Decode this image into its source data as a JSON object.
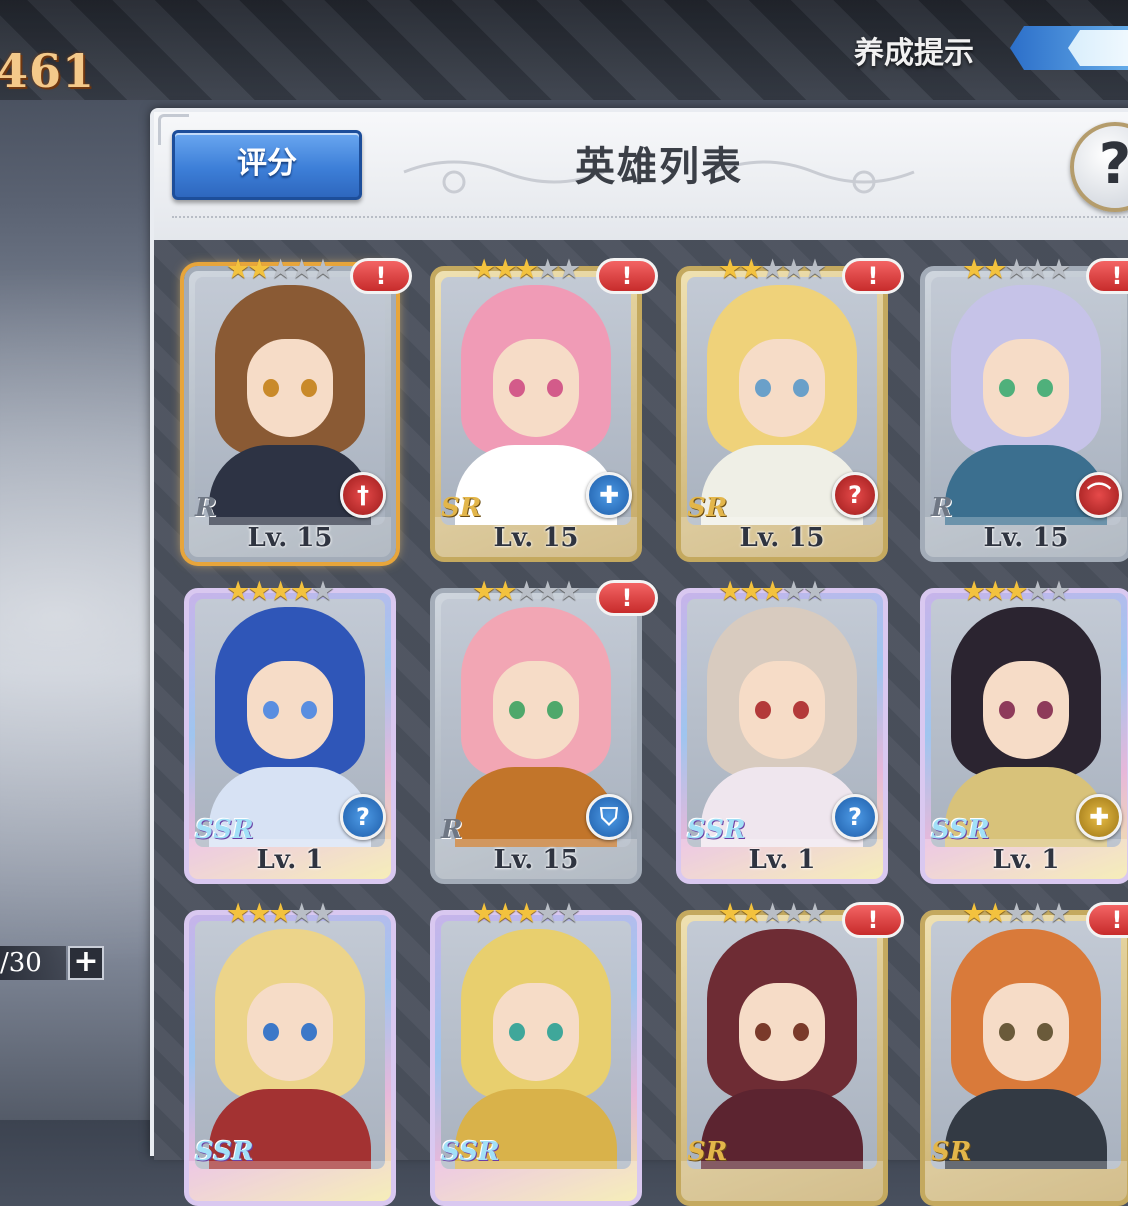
{
  "hud": {
    "currency": "461",
    "growth_hint": "养成提示",
    "stock": "/30",
    "plus": "+"
  },
  "panel": {
    "score_button": "评分",
    "title": "英雄列表",
    "help": "?"
  },
  "heroes": [
    {
      "rarity": "R",
      "level": "Lv. 15",
      "stars": 2,
      "alert": "!",
      "role": "sword-icon",
      "role_color": "red",
      "hair": "#8a5a34",
      "eyes": "#c98a2a",
      "body": "#2d3344",
      "selected": true
    },
    {
      "rarity": "SR",
      "level": "Lv. 15",
      "stars": 3,
      "alert": "!",
      "role": "healer-cross-icon",
      "role_color": "blue",
      "hair": "#f09bb6",
      "eyes": "#d35b8a",
      "body": "#ffffff",
      "selected": false
    },
    {
      "rarity": "SR",
      "level": "Lv. 15",
      "stars": 2,
      "alert": "!",
      "role": "mystery-question-icon",
      "role_color": "red",
      "hair": "#efd27a",
      "eyes": "#6aa0c9",
      "body": "#efefe6",
      "selected": false
    },
    {
      "rarity": "R",
      "level": "Lv. 15",
      "stars": 2,
      "alert": "!",
      "role": "bow-icon",
      "role_color": "red",
      "hair": "#c6c3e8",
      "eyes": "#4fb07b",
      "body": "#3b6f8f",
      "selected": false
    },
    {
      "rarity": "SSR",
      "level": "Lv. 1",
      "stars": 4,
      "alert": "",
      "role": "mystery-question-icon",
      "role_color": "blue",
      "hair": "#2f56b8",
      "eyes": "#5a8ee0",
      "body": "#d7e2f4",
      "selected": false
    },
    {
      "rarity": "R",
      "level": "Lv. 15",
      "stars": 2,
      "alert": "!",
      "role": "shield-icon",
      "role_color": "blue",
      "hair": "#f2a6b4",
      "eyes": "#4fa86b",
      "body": "#c2752a",
      "selected": false
    },
    {
      "rarity": "SSR",
      "level": "Lv. 1",
      "stars": 3,
      "alert": "",
      "role": "mystery-question-icon",
      "role_color": "blue",
      "hair": "#d8cbbf",
      "eyes": "#b33a3a",
      "body": "#efe6ee",
      "selected": false
    },
    {
      "rarity": "SSR",
      "level": "Lv. 1",
      "stars": 3,
      "alert": "",
      "role": "healer-cross-icon",
      "role_color": "gold",
      "hair": "#2b2430",
      "eyes": "#8e3b5a",
      "body": "#d8c27a",
      "selected": false
    },
    {
      "rarity": "SSR",
      "level": "",
      "stars": 3,
      "alert": "",
      "role": "",
      "role_color": "",
      "hair": "#ecd48a",
      "eyes": "#3c78c8",
      "body": "#a33232",
      "selected": false
    },
    {
      "rarity": "SSR",
      "level": "",
      "stars": 3,
      "alert": "",
      "role": "",
      "role_color": "",
      "hair": "#e8cf6e",
      "eyes": "#3fa79a",
      "body": "#d9b24a",
      "selected": false
    },
    {
      "rarity": "SR",
      "level": "",
      "stars": 2,
      "alert": "!",
      "role": "",
      "role_color": "",
      "hair": "#6e2c34",
      "eyes": "#7a3a2a",
      "body": "#5c2430",
      "selected": false
    },
    {
      "rarity": "SR",
      "level": "",
      "stars": 2,
      "alert": "!",
      "role": "",
      "role_color": "",
      "hair": "#d97a3a",
      "eyes": "#6a5a3a",
      "body": "#333a44",
      "selected": false
    }
  ]
}
